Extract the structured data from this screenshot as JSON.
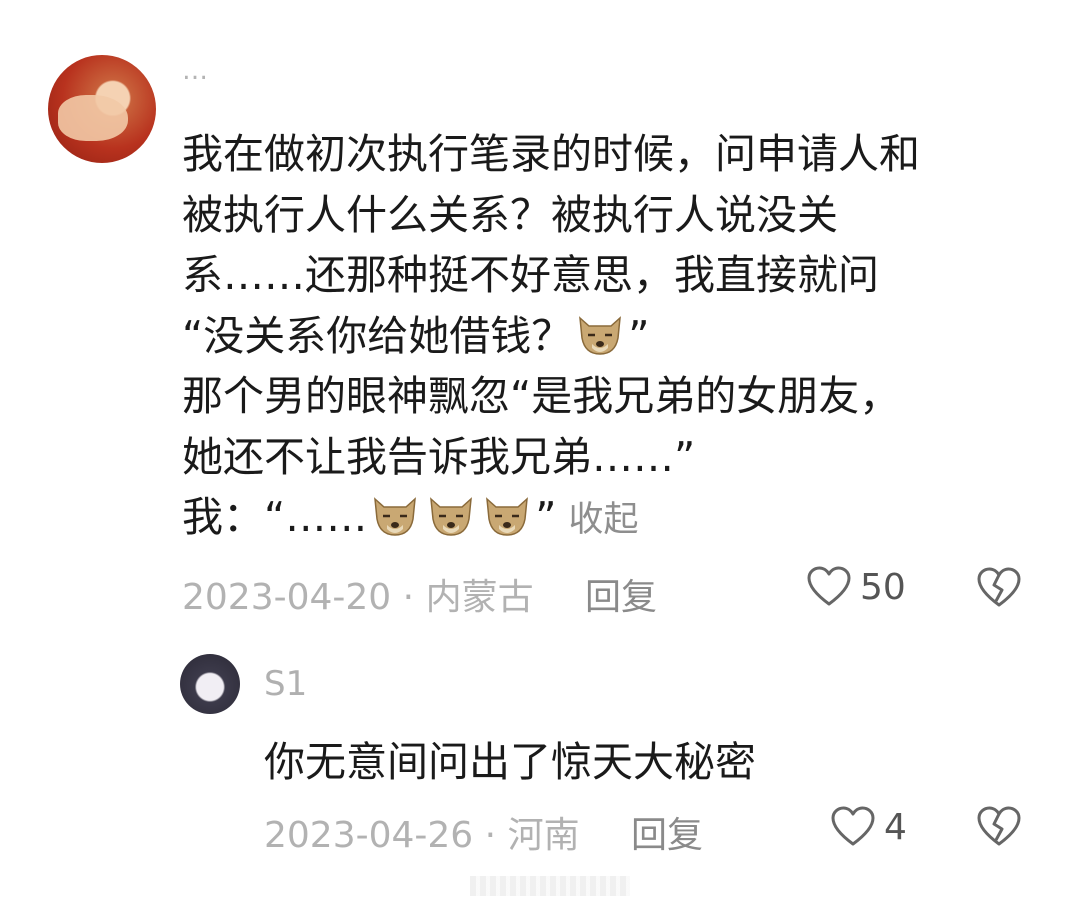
{
  "main_comment": {
    "username": "…",
    "text_lines": [
      "我在做初次执行笔录的时候，问申请人和",
      "被执行人什么关系？被执行人说没关",
      "系……还那种挺不好意思，我直接就问",
      "“没关系你给她借钱？",
      "那个男的眼神飘忽“是我兄弟的女朋友，",
      "她还不让我告诉我兄弟……”",
      "我：“……"
    ],
    "quote_close": "”",
    "collapse_label": "收起",
    "date": "2023-04-20",
    "separator": "·",
    "location": "内蒙古",
    "reply_label": "回复",
    "likes": "50",
    "icons": {
      "like": "heart-outline-icon",
      "dislike": "broken-heart-icon",
      "emoji": "dog-face-emoji"
    }
  },
  "sub_comment": {
    "username": "S1",
    "text": "你无意间问出了惊天大秘密",
    "date": "2023-04-26",
    "separator": "·",
    "location": "河南",
    "reply_label": "回复",
    "likes": "4"
  },
  "colors": {
    "meta": "#b2b2b2",
    "text": "#1a1a1a",
    "icon": "#666666"
  }
}
